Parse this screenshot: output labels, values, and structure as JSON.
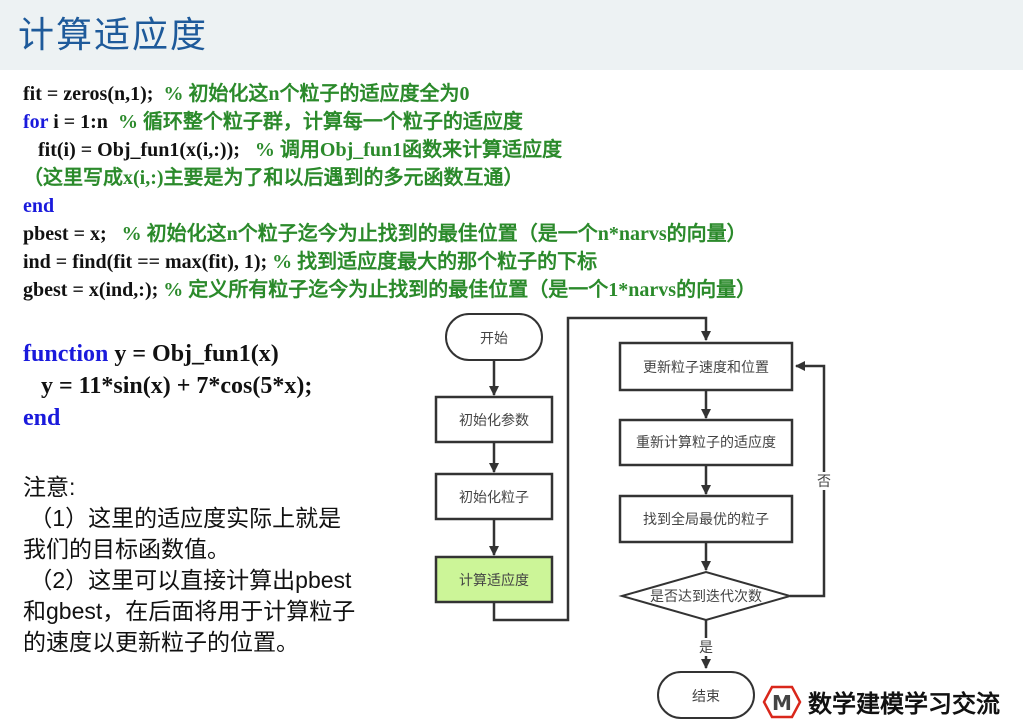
{
  "title": "计算适应度",
  "code_lines": [
    {
      "code": "fit = zeros(n,1);",
      "keyword": "",
      "comment": "% 初始化这n个粒子的适应度全为0"
    },
    {
      "code": " i = 1:n",
      "keyword": "for",
      "comment": "% 循环整个粒子群，计算每一个粒子的适应度"
    },
    {
      "code": "   fit(i) = Obj_fun1(x(i,:));",
      "keyword": "",
      "comment": "% 调用Obj_fun1函数来计算适应度"
    },
    {
      "code": "",
      "keyword": "",
      "comment": "（这里写成x(i,:)主要是为了和以后遇到的多元函数互通）"
    },
    {
      "code": "",
      "keyword": "end",
      "comment": ""
    },
    {
      "code": "pbest = x;",
      "keyword": "",
      "comment": "% 初始化这n个粒子迄今为止找到的最佳位置（是一个n*narvs的向量）"
    },
    {
      "code": "ind = find(fit == max(fit), 1);",
      "keyword": "",
      "comment": "% 找到适应度最大的那个粒子的下标"
    },
    {
      "code": "gbest = x(ind,:);",
      "keyword": "",
      "comment": "% 定义所有粒子迄今为止找到的最佳位置（是一个1*narvs的向量）"
    }
  ],
  "function_block": {
    "keyword_function": "function",
    "signature": " y = Obj_fun1(x)",
    "body": "   y = 11*sin(x) + 7*cos(5*x);",
    "keyword_end": "end"
  },
  "note": {
    "heading": "注意:",
    "lines": [
      " （1）这里的适应度实际上就是",
      "我们的目标函数值。",
      " （2）这里可以直接计算出pbest",
      "和gbest，在后面将用于计算粒子",
      "的速度以更新粒子的位置。"
    ]
  },
  "flowchart": {
    "start": "开始",
    "init_params": "初始化参数",
    "init_particles": "初始化粒子",
    "calc_fitness": "计算适应度",
    "update_velocity": "更新粒子速度和位置",
    "recalc_fitness": "重新计算粒子的适应度",
    "find_global_best": "找到全局最优的粒子",
    "decision": "是否达到迭代次数",
    "no_label": "否",
    "yes_label": "是",
    "end": "结束",
    "highlight_color": "#ccf598"
  },
  "logo": {
    "letter": "M",
    "text": "数学建模学习交流",
    "color": "#d9271b"
  }
}
